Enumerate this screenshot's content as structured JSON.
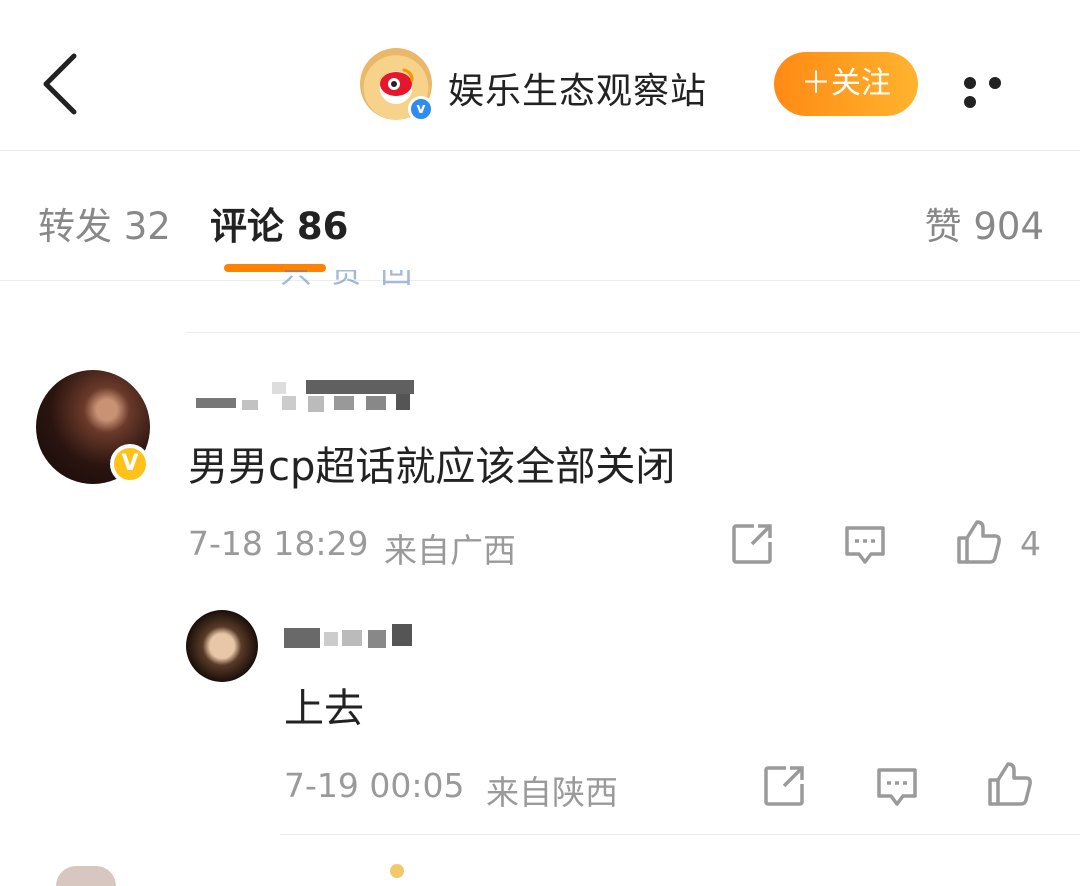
{
  "header": {
    "back_icon": "chevron-left-icon",
    "account_name": "娱乐生态观察站",
    "verified_badge": "v",
    "follow_label": "＋关注",
    "follow_color": "#ff8a15",
    "more_icon": "more-horizontal-icon"
  },
  "tabs": {
    "repost": "转发 32",
    "comments": "评论 86",
    "likes": "赞 904",
    "active_color": "#ff8200"
  },
  "cutoff_text": "只 赞 回 复",
  "comments": [
    {
      "verified_badge": "V",
      "text": "男男cp超话就应该全部关闭",
      "time": "7-18 18:29",
      "location": "来自广西",
      "like_count": "4",
      "reply": {
        "text": "上去",
        "time": "7-19 00:05",
        "location": "来自陕西"
      }
    }
  ]
}
